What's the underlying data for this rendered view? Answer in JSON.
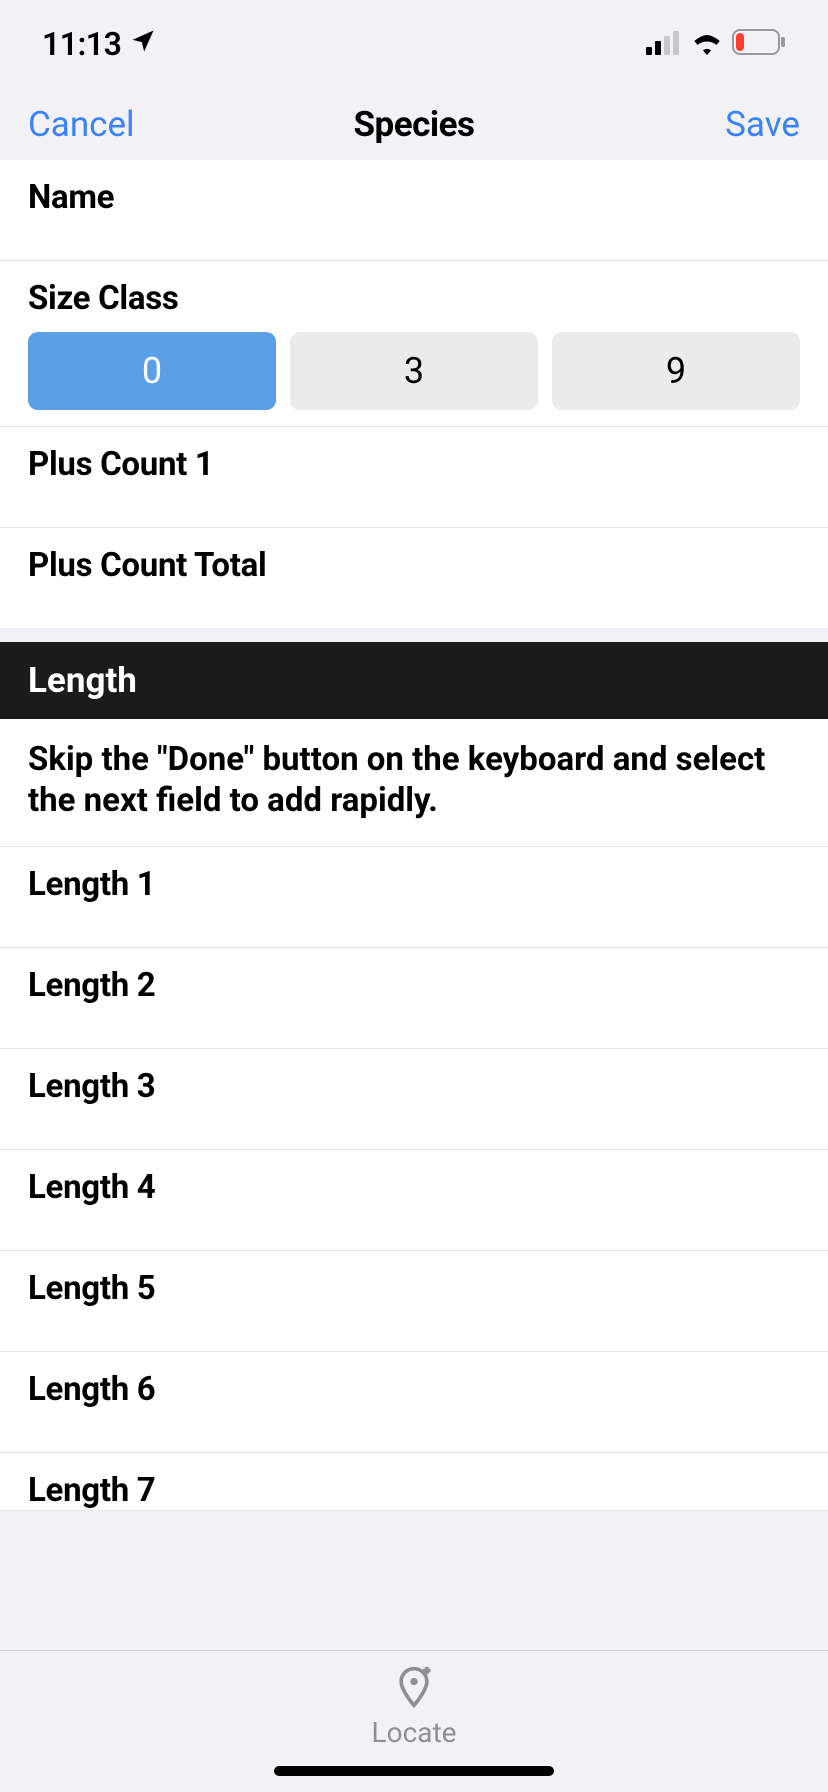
{
  "status_bar": {
    "time": "11:13"
  },
  "nav": {
    "cancel": "Cancel",
    "title": "Species",
    "save": "Save"
  },
  "fields": {
    "name_label": "Name",
    "name_value": "",
    "size_class_label": "Size Class",
    "size_class_options": [
      "0",
      "3",
      "9"
    ],
    "size_class_selected": "0",
    "plus_count_1_label": "Plus Count 1",
    "plus_count_1_value": "",
    "plus_count_total_label": "Plus Count Total",
    "plus_count_total_value": ""
  },
  "length_section": {
    "header": "Length",
    "hint": "Skip the \"Done\" button on the keyboard and select the next field to add rapidly.",
    "items": [
      {
        "label": "Length 1",
        "value": ""
      },
      {
        "label": "Length 2",
        "value": ""
      },
      {
        "label": "Length 3",
        "value": ""
      },
      {
        "label": "Length 4",
        "value": ""
      },
      {
        "label": "Length 5",
        "value": ""
      },
      {
        "label": "Length 6",
        "value": ""
      },
      {
        "label": "Length 7",
        "value": ""
      }
    ]
  },
  "bottom": {
    "locate": "Locate"
  }
}
